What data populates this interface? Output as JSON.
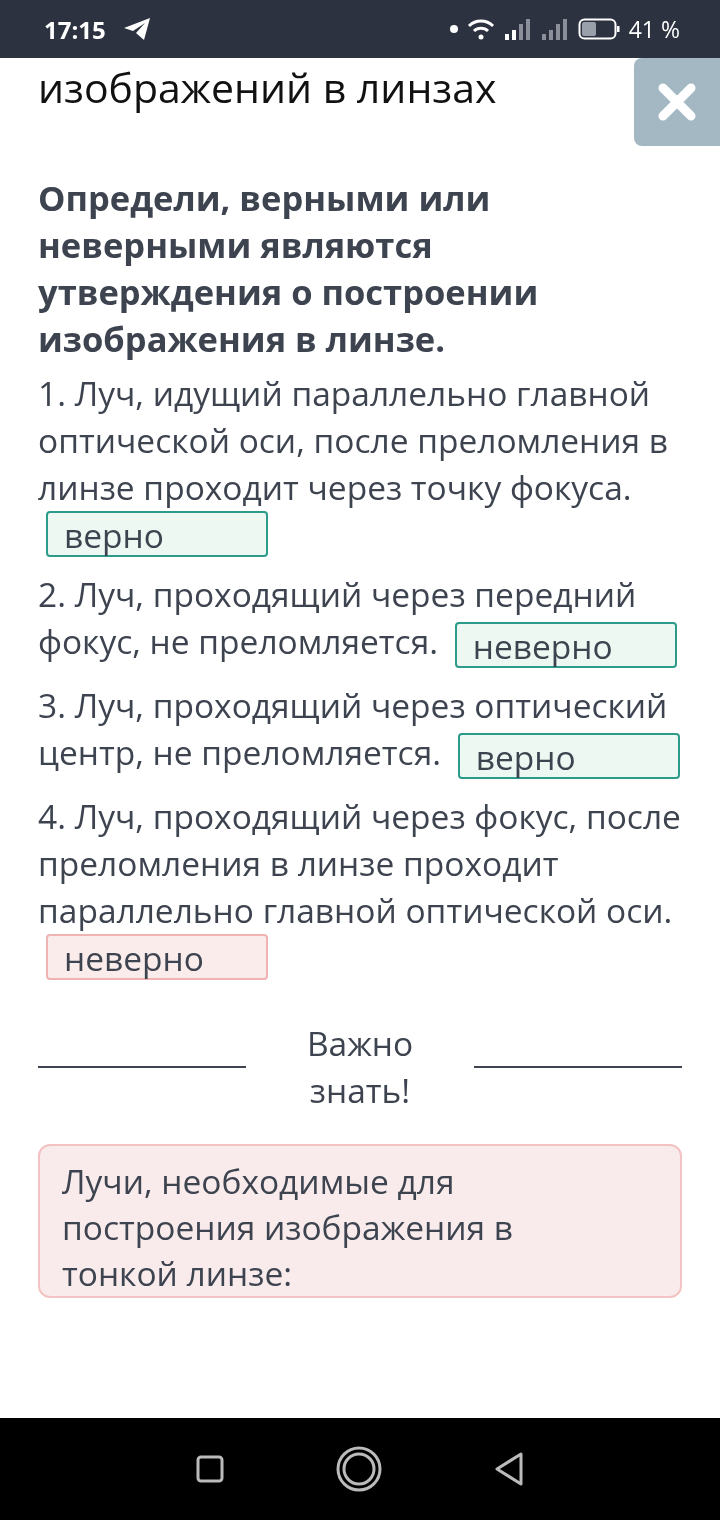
{
  "status_bar": {
    "time": "17:15",
    "battery": "41 %"
  },
  "header": {
    "title": "изображений в линзах"
  },
  "question": "Определи, верными или неверными являются утверждения о построении изображения в линзе.",
  "statements": [
    {
      "text": "1. Луч, идущий параллельно главной оптической оси, после преломления в линзе проходит через точку фокуса.",
      "answer": "верно",
      "correct": true
    },
    {
      "text": "2. Луч, проходящий через передний фокус, не преломляется.",
      "answer": "неверно",
      "correct": true
    },
    {
      "text": "3. Луч, проходящий через оптический центр, не преломляется.",
      "answer": "верно",
      "correct": true
    },
    {
      "text": "4. Луч, проходящий через фокус, после преломления в линзе проходит параллельно главной оптической оси.",
      "answer": "неверно",
      "correct": false
    }
  ],
  "divider": {
    "label": "Важно знать!"
  },
  "info_box": {
    "text": "Лучи, необходимые для построения изображения в тонкой линзе:"
  }
}
